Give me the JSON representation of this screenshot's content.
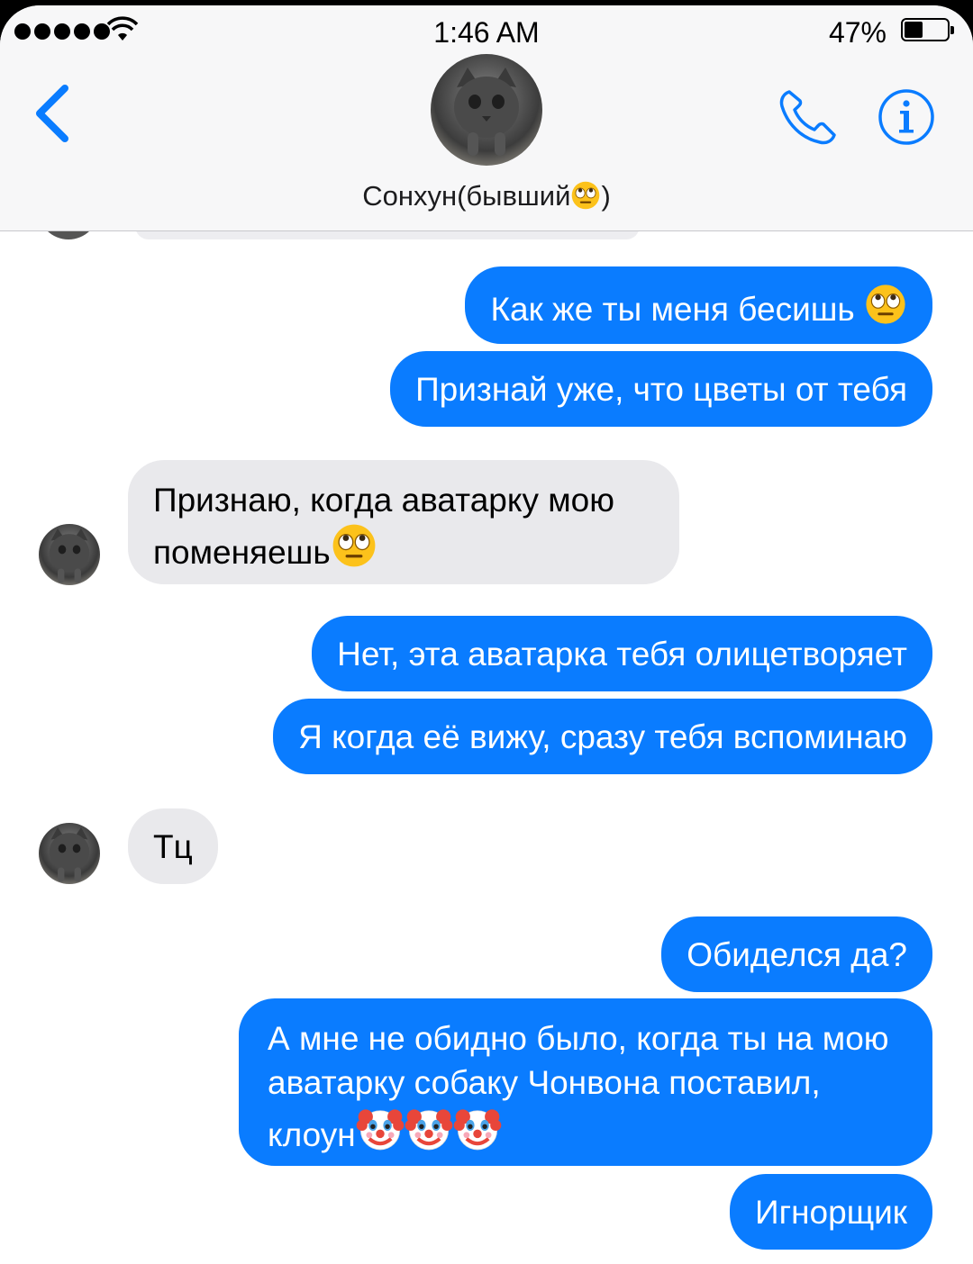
{
  "status_bar": {
    "time": "1:46 AM",
    "battery_percent": "47%",
    "battery_level": 0.47,
    "signal_dots": 5,
    "wifi_icon": "wifi-icon"
  },
  "header": {
    "back_icon": "chevron-left-icon",
    "contact_name": "Сонхун(бывший",
    "contact_name_end": ")",
    "phone_icon": "phone-icon",
    "info_icon": "info-icon",
    "accent_color": "#0a7cff"
  },
  "messages": [
    {
      "dir": "out",
      "text": "Как же ты меня бесишь ",
      "emoji": "face-with-rolling-eyes"
    },
    {
      "dir": "out",
      "text": "Признай уже, что цветы от тебя"
    },
    {
      "dir": "in",
      "line1": "Признаю, когда аватарку мою",
      "line2": "поменяешь",
      "emoji": "face-with-rolling-eyes"
    },
    {
      "dir": "out",
      "text": "Нет, эта аватарка тебя олицетворяет"
    },
    {
      "dir": "out",
      "text": "Я когда её вижу, сразу тебя вспоминаю"
    },
    {
      "dir": "in",
      "text": "Тц"
    },
    {
      "dir": "out",
      "text": "Обиделся да?"
    },
    {
      "dir": "out",
      "line1": "А мне не обидно было, когда ты на мою",
      "line2": "аватарку собаку Чонвона поставил,",
      "line3": "клоун",
      "emoji": "clown-face",
      "emoji_count": 3
    },
    {
      "dir": "out",
      "text": "Игнорщик"
    }
  ],
  "colors": {
    "outgoing_bubble": "#0a7cff",
    "incoming_bubble": "#e9e9ec"
  }
}
